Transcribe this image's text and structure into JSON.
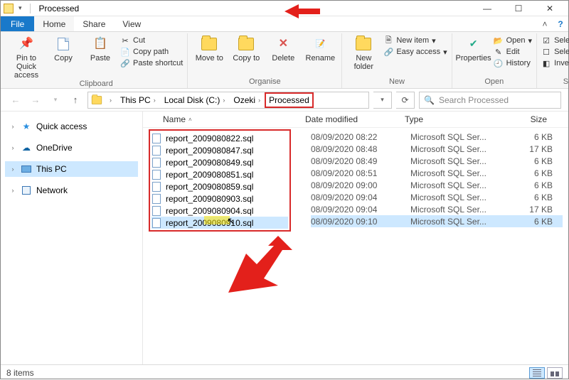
{
  "window": {
    "title": "Processed"
  },
  "menu": {
    "file": "File",
    "home": "Home",
    "share": "Share",
    "view": "View"
  },
  "ribbon": {
    "clipboard": {
      "label": "Clipboard",
      "pin": "Pin to Quick access",
      "copy": "Copy",
      "paste": "Paste",
      "cut": "Cut",
      "copypath": "Copy path",
      "pasteshortcut": "Paste shortcut"
    },
    "organise": {
      "label": "Organise",
      "moveto": "Move to",
      "copyto": "Copy to",
      "delete": "Delete",
      "rename": "Rename"
    },
    "new": {
      "label": "New",
      "newfolder": "New folder",
      "newitem": "New item",
      "easyaccess": "Easy access"
    },
    "open": {
      "label": "Open",
      "properties": "Properties",
      "open": "Open",
      "edit": "Edit",
      "history": "History"
    },
    "select": {
      "label": "Select",
      "selectall": "Select all",
      "selectnone": "Select none",
      "invert": "Invert selection"
    }
  },
  "breadcrumb": {
    "p0": "This PC",
    "p1": "Local Disk (C:)",
    "p2": "Ozeki",
    "p3": "Processed"
  },
  "search": {
    "placeholder": "Search Processed"
  },
  "sidebar": {
    "quick": "Quick access",
    "onedrive": "OneDrive",
    "thispc": "This PC",
    "network": "Network"
  },
  "columns": {
    "name": "Name",
    "date": "Date modified",
    "type": "Type",
    "size": "Size"
  },
  "files": [
    {
      "name": "report_2009080822.sql",
      "date": "08/09/2020 08:22",
      "type": "Microsoft SQL Ser...",
      "size": "6 KB"
    },
    {
      "name": "report_2009080847.sql",
      "date": "08/09/2020 08:48",
      "type": "Microsoft SQL Ser...",
      "size": "17 KB"
    },
    {
      "name": "report_2009080849.sql",
      "date": "08/09/2020 08:49",
      "type": "Microsoft SQL Ser...",
      "size": "6 KB"
    },
    {
      "name": "report_2009080851.sql",
      "date": "08/09/2020 08:51",
      "type": "Microsoft SQL Ser...",
      "size": "6 KB"
    },
    {
      "name": "report_2009080859.sql",
      "date": "08/09/2020 09:00",
      "type": "Microsoft SQL Ser...",
      "size": "6 KB"
    },
    {
      "name": "report_2009080903.sql",
      "date": "08/09/2020 09:04",
      "type": "Microsoft SQL Ser...",
      "size": "6 KB"
    },
    {
      "name": "report_2009080904.sql",
      "date": "08/09/2020 09:04",
      "type": "Microsoft SQL Ser...",
      "size": "17 KB"
    },
    {
      "name": "report_2009080910.sql",
      "date": "08/09/2020 09:10",
      "type": "Microsoft SQL Ser...",
      "size": "6 KB"
    }
  ],
  "status": {
    "count": "8 items"
  }
}
